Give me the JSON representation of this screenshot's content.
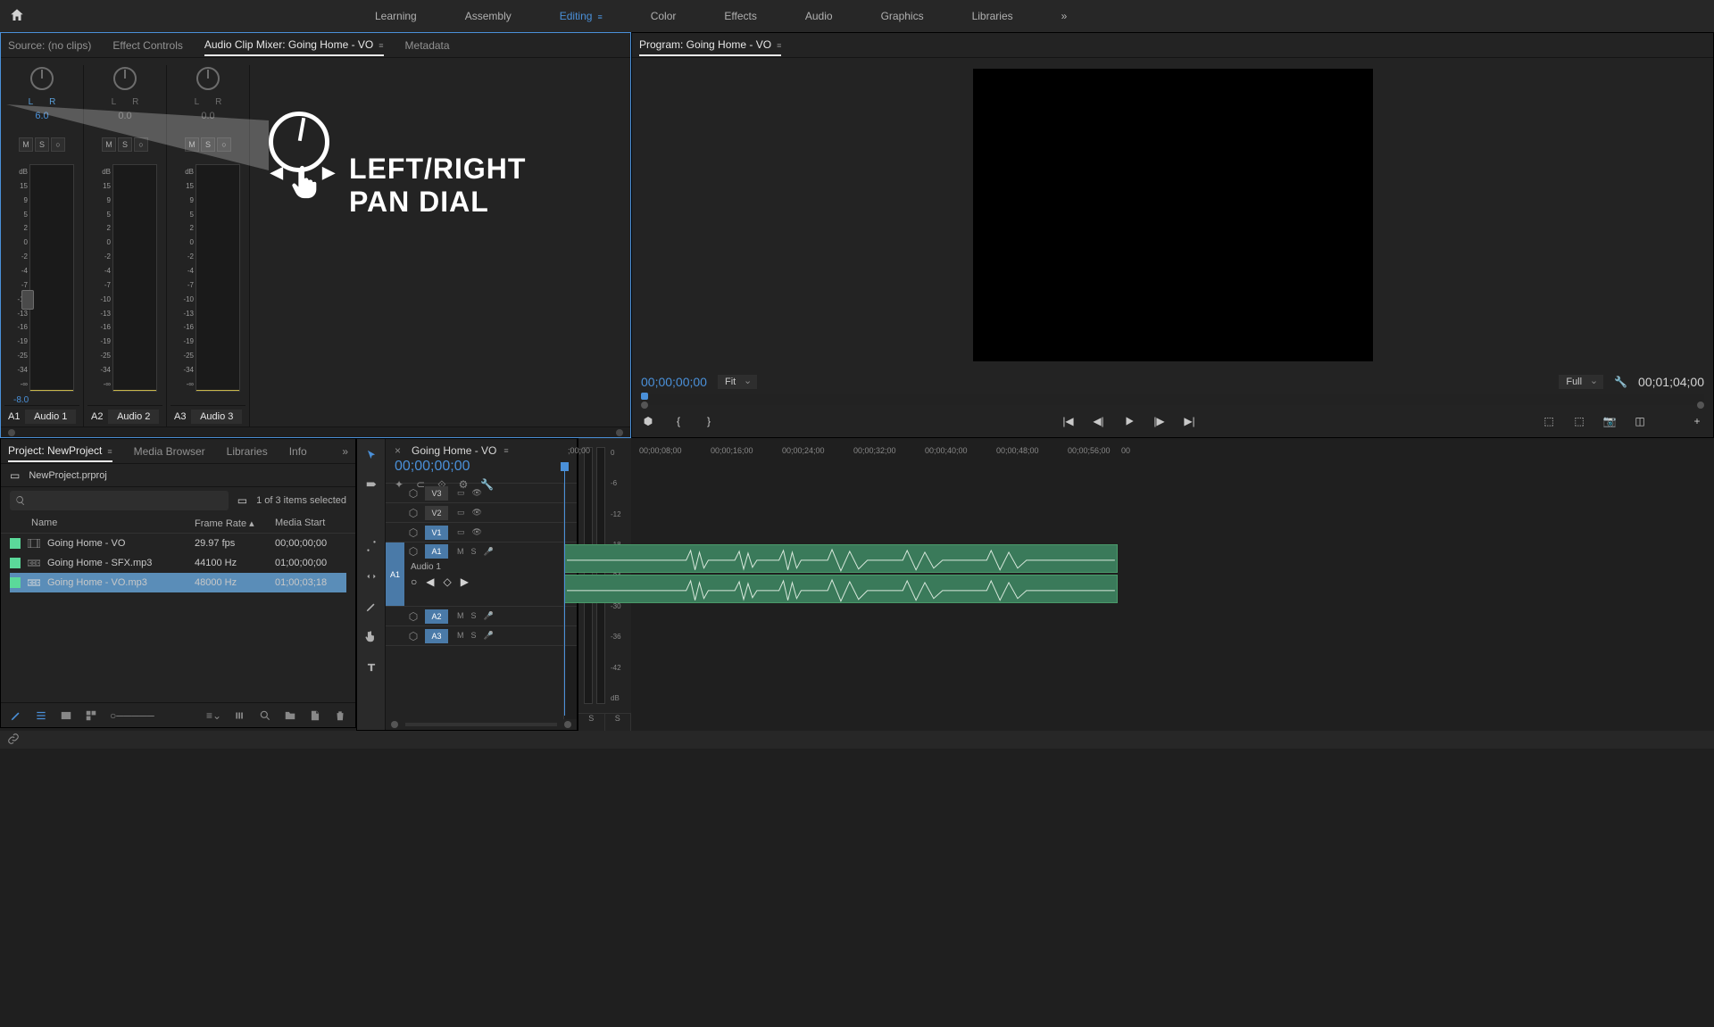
{
  "workspaces": {
    "items": [
      "Learning",
      "Assembly",
      "Editing",
      "Color",
      "Effects",
      "Audio",
      "Graphics",
      "Libraries"
    ],
    "active": "Editing"
  },
  "mixer": {
    "tabs": {
      "source": "Source: (no clips)",
      "effect": "Effect Controls",
      "mixer": "Audio Clip Mixer: Going Home - VO",
      "metadata": "Metadata"
    },
    "channels": [
      {
        "id": "A1",
        "name": "Audio 1",
        "pan": "6.0",
        "vol": "-8.0",
        "active": true
      },
      {
        "id": "A2",
        "name": "Audio 2",
        "pan": "0.0",
        "vol": "",
        "active": false
      },
      {
        "id": "A3",
        "name": "Audio 3",
        "pan": "0.0",
        "vol": "",
        "active": false
      }
    ],
    "db_scale": [
      "dB",
      "15",
      "9",
      "5",
      "2",
      "0",
      "-2",
      "-4",
      "-7",
      "-10",
      "-13",
      "-16",
      "-19",
      "-25",
      "-34",
      "-∞"
    ],
    "overlay_label": "LEFT/RIGHT PAN DIAL"
  },
  "program": {
    "title": "Program: Going Home - VO",
    "tc_left": "00;00;00;00",
    "fit": "Fit",
    "full": "Full",
    "tc_right": "00;01;04;00"
  },
  "project": {
    "tabs": {
      "project": "Project: NewProject",
      "media": "Media Browser",
      "libraries": "Libraries",
      "info": "Info"
    },
    "name": "NewProject.prproj",
    "selection": "1 of 3 items selected",
    "cols": {
      "name": "Name",
      "frame": "Frame Rate",
      "start": "Media Start"
    },
    "items": [
      {
        "name": "Going Home - VO",
        "frame": "29.97 fps",
        "start": "00;00;00;00",
        "selected": false,
        "type": "seq"
      },
      {
        "name": "Going Home - SFX.mp3",
        "frame": "44100 Hz",
        "start": "01;00;00;00",
        "selected": false,
        "type": "audio"
      },
      {
        "name": "Going Home - VO.mp3",
        "frame": "48000 Hz",
        "start": "01;00;03;18",
        "selected": true,
        "type": "audio"
      }
    ]
  },
  "timeline": {
    "sequence": "Going Home - VO",
    "tc": "00;00;00;00",
    "ticks": [
      ";00;00",
      "00;00;08;00",
      "00;00;16;00",
      "00;00;24;00",
      "00;00;32;00",
      "00;00;40;00",
      "00;00;48;00",
      "00;00;56;00",
      "00"
    ],
    "video_tracks": [
      "V3",
      "V2",
      "V1"
    ],
    "audio_tracks": [
      {
        "id": "A1",
        "name": "Audio 1",
        "expanded": true
      },
      {
        "id": "A2",
        "name": "",
        "expanded": false
      },
      {
        "id": "A3",
        "name": "",
        "expanded": false
      }
    ]
  },
  "meter": {
    "scale": [
      "0",
      "-6",
      "-12",
      "-18",
      "-24",
      "-30",
      "-36",
      "-42",
      "dB"
    ]
  }
}
